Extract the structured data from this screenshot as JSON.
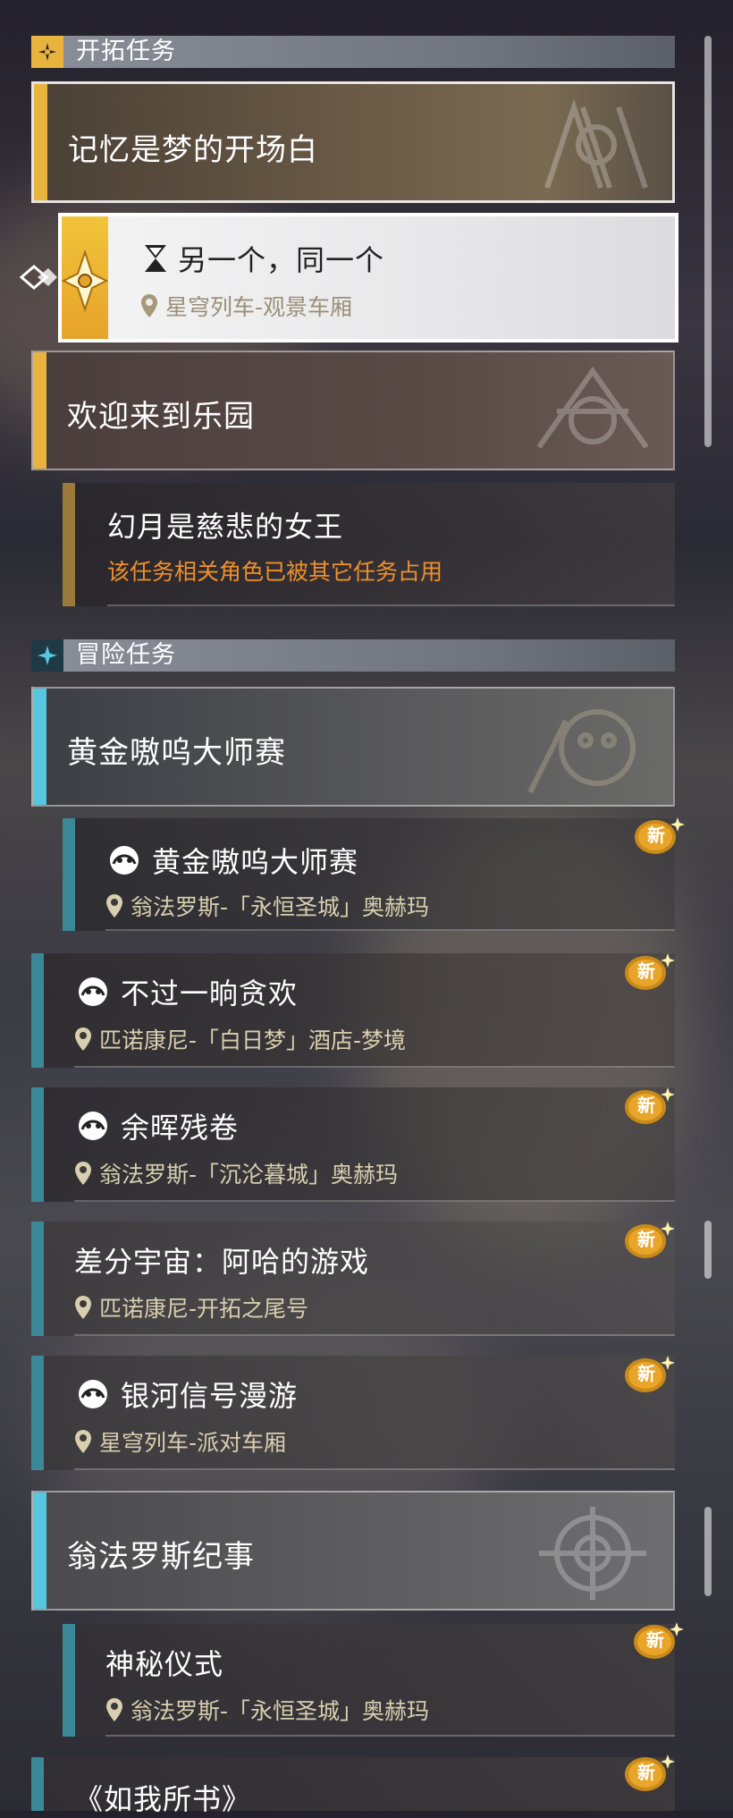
{
  "colors": {
    "trailblaze": "#e8b43e",
    "adventure": "#55c8e0",
    "warning": "#f0902a",
    "location": "#d8cfae"
  },
  "trailblaze": {
    "header": "开拓任务",
    "main1": "记忆是梦的开场白",
    "selected": {
      "title": "另一个，同一个",
      "location": "星穹列车-观景车厢"
    },
    "main2": "欢迎来到乐园",
    "sub2": {
      "title": "幻月是慈悲的女王",
      "note": "该任务相关角色已被其它任务占用"
    }
  },
  "adventure": {
    "header": "冒险任务",
    "group1": "黄金嗷呜大师赛",
    "items": [
      {
        "title": "黄金嗷呜大师赛",
        "location": "翁法罗斯-「永恒圣城」奥赫玛",
        "badge": "新"
      },
      {
        "title": "不过一晌贪欢",
        "location": "匹诺康尼-「白日梦」酒店-梦境",
        "badge": "新"
      },
      {
        "title": "余晖残卷",
        "location": "翁法罗斯-「沉沦暮城」奥赫玛",
        "badge": "新"
      },
      {
        "title": "差分宇宙：阿哈的游戏",
        "location": "匹诺康尼-开拓之尾号",
        "badge": "新"
      },
      {
        "title": "银河信号漫游",
        "location": "星穹列车-派对车厢",
        "badge": "新"
      }
    ],
    "group2": "翁法罗斯纪事",
    "items2": [
      {
        "title": "神秘仪式",
        "location": "翁法罗斯-「永恒圣城」奥赫玛",
        "badge": "新"
      },
      {
        "title": "《如我所书》",
        "badge": "新"
      }
    ]
  }
}
